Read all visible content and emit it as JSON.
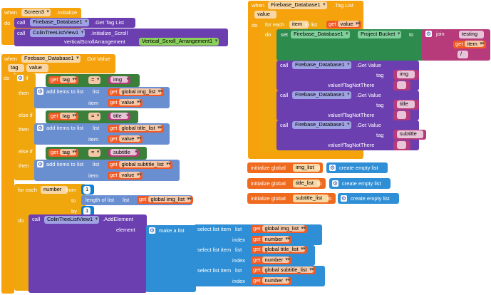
{
  "screen_init": {
    "when": "when",
    "component": "Screen3",
    "event": ".Initialize",
    "do": "do",
    "call1": "call",
    "call1_component": "Firebase_Database1",
    "call1_method": ".Get Tag List",
    "call2": "call",
    "call2_component": "ColinTreeListView1",
    "call2_method": ".Initialize_Scroll",
    "param_label": "verticalScrollArrangement",
    "param_value": "Vertical_Scroll_Arrangement1"
  },
  "got_value": {
    "when": "when",
    "component": "Firebase_Database1",
    "event": ".Got Value",
    "params": [
      "tag",
      "value"
    ],
    "do": "do",
    "if": "if",
    "then": "then",
    "else_if": "else if",
    "get": "get",
    "tag_var": "tag",
    "eq": "=",
    "add_items": "add items to list",
    "list": "list",
    "item": "item",
    "value_var": "value",
    "branches": [
      {
        "cond": "img",
        "list": "global img_list"
      },
      {
        "cond": "title",
        "list": "global title_list"
      },
      {
        "cond": "subtitle",
        "list": "global subtitle_list"
      }
    ],
    "for_each": "for each",
    "number_var": "number",
    "from": "from",
    "from_value": "1",
    "to": "to",
    "length_of_list": "length of list",
    "length_list": "global img_list",
    "by": "by",
    "by_value": "1",
    "call": "call",
    "add_component": "ColinTreeListView1",
    "add_method": ".AddElement",
    "element": "element",
    "make_list": "make a list",
    "select_item": "select list item",
    "index": "index",
    "select_lists": [
      "global img_list",
      "global title_list",
      "global subtitle_list"
    ]
  },
  "tag_list": {
    "when": "when",
    "component": "Firebase_Database1",
    "event": ".Tag List",
    "param": "value",
    "do": "do",
    "for_each": "for each",
    "item_var": "item",
    "in_list": "in list",
    "get": "get",
    "value_var": "value",
    "set": "set",
    "set_component": "Firebase_Database1",
    "set_prop": "Project Bucket",
    "to": "to",
    "join": "join",
    "join_items": [
      "testing",
      "item",
      "/"
    ],
    "call": "call",
    "getvalue_component": "Firebase_Database1",
    "getvalue_method": ".Get Value",
    "tag_label": "tag",
    "not_there": "valueIfTagNotThere",
    "tags": [
      "img",
      "title",
      "subtitle"
    ],
    "empty_string": ""
  },
  "globals": [
    {
      "label": "initialize global",
      "name": "img_list",
      "to": "to",
      "value": "create empty list"
    },
    {
      "label": "initialize global",
      "name": "title_list",
      "to": "to",
      "value": "create empty list"
    },
    {
      "label": "initialize global",
      "name": "subtitle_list",
      "to": "to",
      "value": "create empty list"
    }
  ],
  "colors": {
    "event": "#f5a20c",
    "component_call": "#6b3fb0",
    "list": "#6a8fd0",
    "getter": "#f15a24",
    "text": "#b73a7a",
    "logic": "#3a7f3a",
    "math": "#0f7fd6"
  }
}
